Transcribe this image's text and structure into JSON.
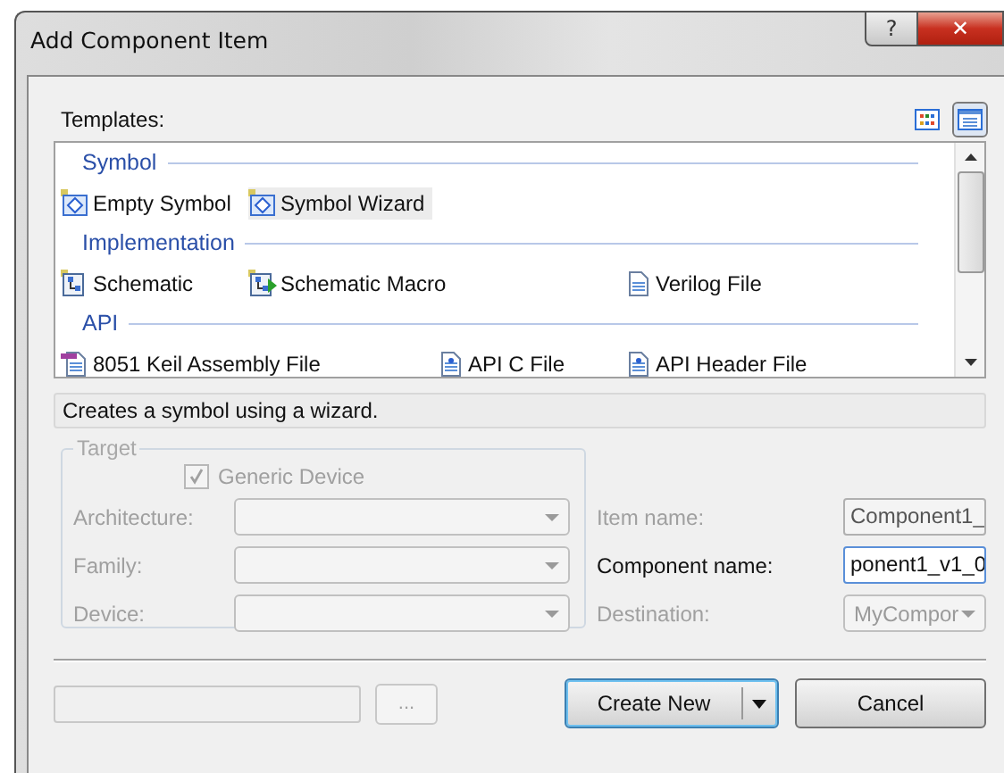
{
  "window": {
    "title": "Add Component Item",
    "help_button": "?",
    "close_button": "✕"
  },
  "templates": {
    "label": "Templates:",
    "view_buttons": [
      {
        "selected": false
      },
      {
        "selected": true
      }
    ],
    "groups": [
      {
        "name": "Symbol",
        "items": [
          {
            "label": "Empty Symbol",
            "kind": "symbol",
            "selected": false
          },
          {
            "label": "Symbol Wizard",
            "kind": "symbol",
            "selected": true
          }
        ]
      },
      {
        "name": "Implementation",
        "items": [
          {
            "label": "Schematic",
            "kind": "schematic",
            "selected": false
          },
          {
            "label": "Schematic Macro",
            "kind": "macro",
            "selected": false
          },
          {
            "label": "Verilog File",
            "kind": "verilog",
            "selected": false
          }
        ]
      },
      {
        "name": "API",
        "items": [
          {
            "label": "8051 Keil Assembly File",
            "kind": "assembly",
            "selected": false
          },
          {
            "label": "API C File",
            "kind": "source",
            "selected": false
          },
          {
            "label": "API Header File",
            "kind": "header",
            "selected": false
          }
        ]
      }
    ]
  },
  "description": "Creates a symbol using a wizard.",
  "target": {
    "legend": "Target",
    "generic_device": {
      "label": "Generic Device",
      "checked": true,
      "disabled": true
    },
    "fields": [
      {
        "label": "Architecture:",
        "disabled": true
      },
      {
        "label": "Family:",
        "disabled": true
      },
      {
        "label": "Device:",
        "disabled": true
      }
    ]
  },
  "item_fields": [
    {
      "label": "Item name:",
      "value": "Component1_",
      "kind": "text",
      "disabled": true
    },
    {
      "label": "Component name:",
      "value": "ponent1_v1_0",
      "kind": "text",
      "disabled": false
    },
    {
      "label": "Destination:",
      "value": "MyCompor",
      "kind": "dropdown",
      "disabled": true
    }
  ],
  "footer": {
    "browse_button": {
      "label": "...",
      "disabled": true
    },
    "create_button": "Create New",
    "cancel_button": "Cancel"
  }
}
